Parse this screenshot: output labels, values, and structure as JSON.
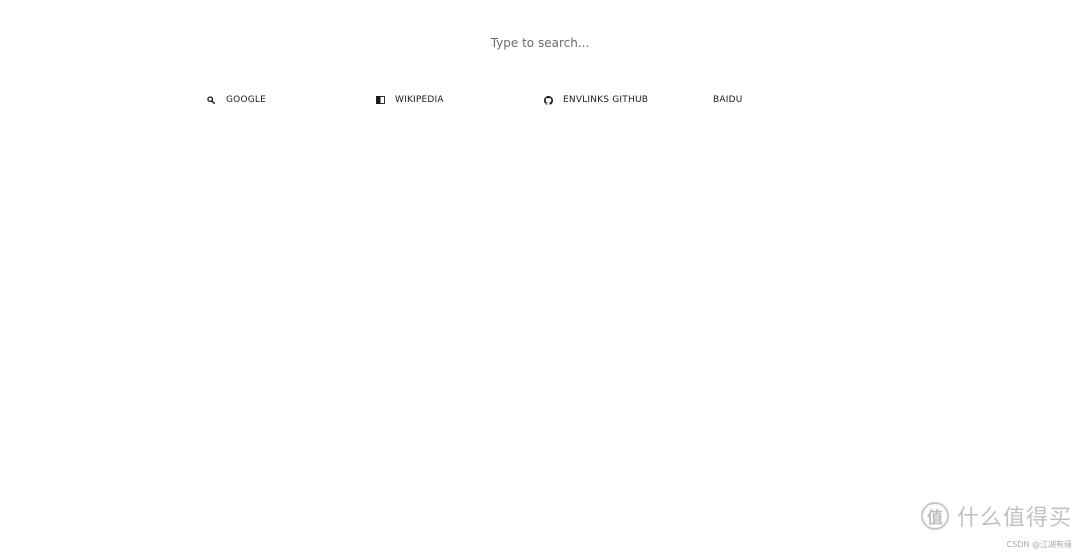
{
  "search": {
    "placeholder": "Type to search..."
  },
  "links": [
    {
      "label": "GOOGLE",
      "icon": "search-icon"
    },
    {
      "label": "WIKIPEDIA",
      "icon": "book-icon"
    },
    {
      "label": "ENVLINKS GITHUB",
      "icon": "github-icon"
    },
    {
      "label": "BAIDU",
      "icon": ""
    }
  ],
  "watermark": {
    "brand_mark": "值",
    "brand_text": "什么值得买",
    "sub_text": "CSDN @江湖有缘"
  },
  "colors": {
    "background": "#ffffff",
    "link_text": "#1a1a1a",
    "placeholder": "#6b6b6b",
    "watermark": "#c2c2c2"
  }
}
